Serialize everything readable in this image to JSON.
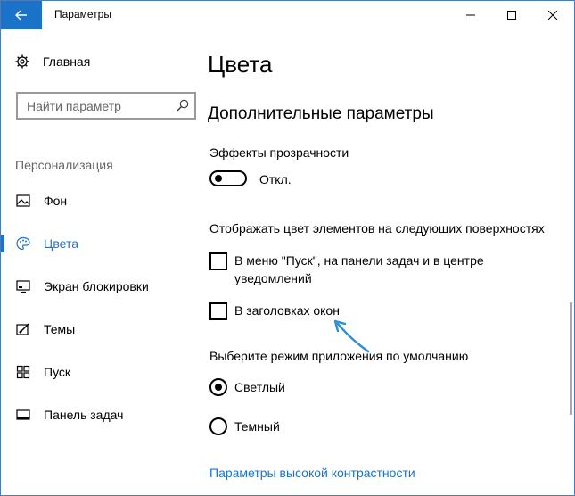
{
  "titlebar": {
    "title": "Параметры"
  },
  "sidebar": {
    "home_label": "Главная",
    "search_placeholder": "Найти параметр",
    "section_label": "Персонализация",
    "items": [
      {
        "label": "Фон",
        "icon": "picture-icon",
        "active": false
      },
      {
        "label": "Цвета",
        "icon": "palette-icon",
        "active": true
      },
      {
        "label": "Экран блокировки",
        "icon": "lock-screen-icon",
        "active": false
      },
      {
        "label": "Темы",
        "icon": "themes-icon",
        "active": false
      },
      {
        "label": "Пуск",
        "icon": "start-icon",
        "active": false
      },
      {
        "label": "Панель задач",
        "icon": "taskbar-icon",
        "active": false
      }
    ]
  },
  "main": {
    "page_title": "Цвета",
    "section_title": "Дополнительные параметры",
    "transparency_label": "Эффекты прозрачности",
    "transparency_state": "Откл.",
    "surfaces_label": "Отображать цвет элементов на следующих поверхностях",
    "checkbox_start_line1": "В меню \"Пуск\", на панели задач и в центре",
    "checkbox_start_line2": "уведомлений",
    "checkbox_titlebars": "В заголовках окон",
    "app_mode_label": "Выберите режим приложения по умолчанию",
    "radio_light": "Светлый",
    "radio_dark": "Темный",
    "high_contrast_link": "Параметры высокой контрастности"
  },
  "colors": {
    "accent": "#1a73c8",
    "annotation_arrow": "#2a8fd6"
  }
}
